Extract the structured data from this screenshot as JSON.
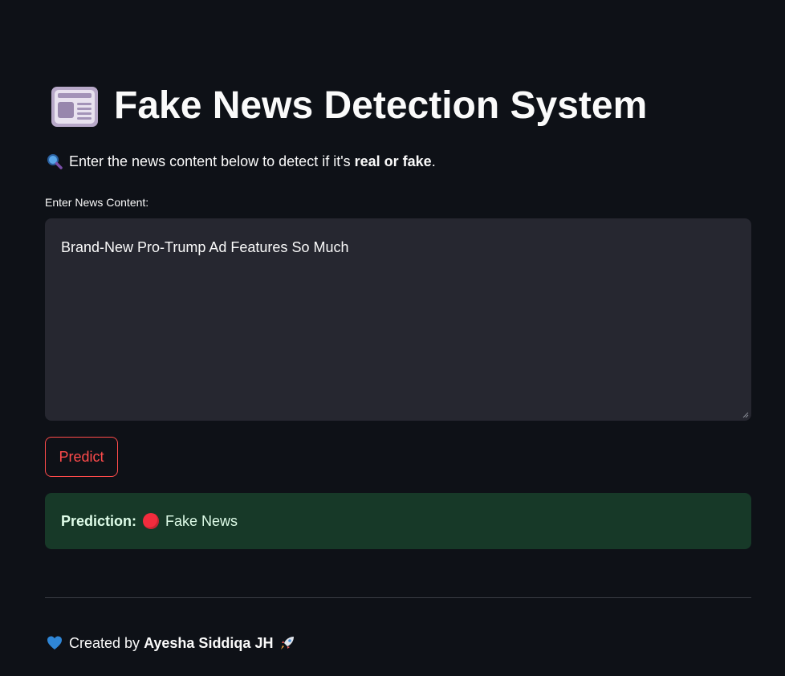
{
  "header": {
    "title": "Fake News Detection System",
    "title_icon": "newspaper-icon"
  },
  "intro": {
    "icon": "magnifying-glass-icon",
    "text_before": "Enter the news content below to detect if it's ",
    "text_bold": "real or fake",
    "text_after": "."
  },
  "input": {
    "label": "Enter News Content:",
    "value": "Brand-New Pro-Trump Ad Features So Much"
  },
  "actions": {
    "predict_label": "Predict"
  },
  "result": {
    "label": "Prediction:",
    "status_icon": "red-circle-icon",
    "value": "Fake News"
  },
  "footer": {
    "heart_icon": "blue-heart-icon",
    "text": "Created by ",
    "author": "Ayesha Siddiqa JH",
    "rocket_icon": "rocket-icon"
  },
  "colors": {
    "background": "#0e1117",
    "input_background": "#262730",
    "accent": "#ff4b4b",
    "success_background": "#173928",
    "success_text": "#dffde9"
  }
}
